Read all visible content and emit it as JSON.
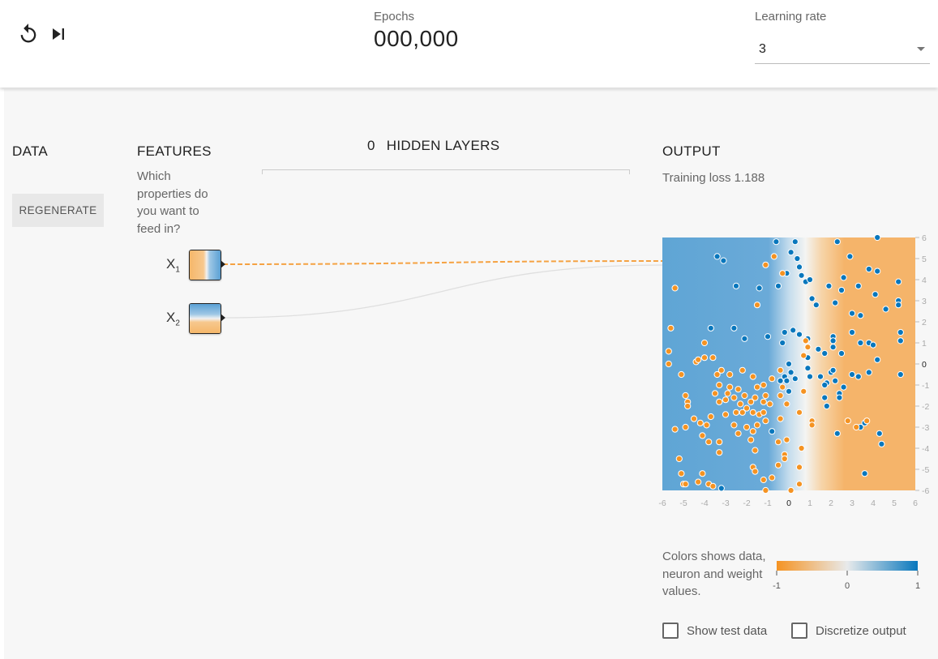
{
  "controls": {
    "reset_icon": "reset-icon",
    "step_icon": "step-forward-icon"
  },
  "epochs": {
    "label": "Epochs",
    "value": "000,000"
  },
  "learning_rate": {
    "label": "Learning rate",
    "value": "3"
  },
  "data_section": {
    "title": "DATA",
    "regenerate_label": "REGENERATE"
  },
  "features_section": {
    "title": "FEATURES",
    "description": "Which properties do you want to feed in?",
    "items": [
      {
        "base": "X",
        "sub": "1"
      },
      {
        "base": "X",
        "sub": "2"
      }
    ]
  },
  "hidden_layers": {
    "count": "0",
    "label": "HIDDEN LAYERS"
  },
  "output_section": {
    "title": "OUTPUT",
    "loss_label": "Training loss",
    "loss_value": "1.188"
  },
  "colors": {
    "orange": "#f59322",
    "light": "#e8eaeb",
    "blue": "#0877bd"
  },
  "color_legend": {
    "description": "Colors shows data, neuron and weight values.",
    "ticks": [
      "-1",
      "0",
      "1"
    ]
  },
  "checkboxes": {
    "show_test_data": "Show test data",
    "discretize_output": "Discretize output"
  },
  "chart_data": {
    "type": "scatter",
    "title": "",
    "xlabel": "",
    "ylabel": "",
    "xlim": [
      -6,
      6
    ],
    "ylim": [
      -6,
      6
    ],
    "x_ticks": [
      "-6",
      "-5",
      "-4",
      "-3",
      "-2",
      "-1",
      "0",
      "1",
      "2",
      "3",
      "4",
      "5",
      "6"
    ],
    "y_ticks": [
      "6",
      "5",
      "4",
      "3",
      "2",
      "1",
      "0",
      "-1",
      "-2",
      "-3",
      "-4",
      "-5",
      "-6"
    ],
    "background": "heatmap of network output: blue (+1) for x < 0.2, orange (-1) for x > 1.4, white at about x = 0.8",
    "series": [
      {
        "color": "blue",
        "points": [
          [
            -3.4,
            5.1
          ],
          [
            -3.1,
            4.9
          ],
          [
            -0.6,
            5.8
          ],
          [
            0.3,
            5.8
          ],
          [
            0.1,
            5.3
          ],
          [
            0.4,
            5.0
          ],
          [
            0.5,
            4.6
          ],
          [
            0.6,
            4.2
          ],
          [
            0.8,
            3.9
          ],
          [
            1.0,
            4.0
          ],
          [
            -0.5,
            3.7
          ],
          [
            -1.4,
            3.6
          ],
          [
            -2.5,
            3.7
          ],
          [
            -0.1,
            4.3
          ],
          [
            2.3,
            5.8
          ],
          [
            2.9,
            5.1
          ],
          [
            3.8,
            4.5
          ],
          [
            4.2,
            4.4
          ],
          [
            4.2,
            6.0
          ],
          [
            5.2,
            3.9
          ],
          [
            2.5,
            3.5
          ],
          [
            2.6,
            4.1
          ],
          [
            1.9,
            3.7
          ],
          [
            3.3,
            3.7
          ],
          [
            4.1,
            3.3
          ],
          [
            1.1,
            3.1
          ],
          [
            1.3,
            2.8
          ],
          [
            2.2,
            2.9
          ],
          [
            3.0,
            2.4
          ],
          [
            3.4,
            2.3
          ],
          [
            4.6,
            2.6
          ],
          [
            5.2,
            3.0
          ],
          [
            5.2,
            2.8
          ],
          [
            -3.7,
            1.7
          ],
          [
            -2.6,
            1.7
          ],
          [
            -2.1,
            1.2
          ],
          [
            -1.0,
            1.3
          ],
          [
            -0.2,
            1.5
          ],
          [
            0.2,
            1.6
          ],
          [
            0.5,
            1.4
          ],
          [
            0.9,
            1.2
          ],
          [
            -0.3,
            1.0
          ],
          [
            0.9,
            0.3
          ],
          [
            1.4,
            0.7
          ],
          [
            1.7,
            0.5
          ],
          [
            2.1,
            1.3
          ],
          [
            2.1,
            1.1
          ],
          [
            2.1,
            0.8
          ],
          [
            2.5,
            0.5
          ],
          [
            3.0,
            1.5
          ],
          [
            3.4,
            1.0
          ],
          [
            3.8,
            1.0
          ],
          [
            4.0,
            0.9
          ],
          [
            5.3,
            1.5
          ],
          [
            5.3,
            1.1
          ],
          [
            0.0,
            0.0
          ],
          [
            0.1,
            -0.4
          ],
          [
            0.3,
            -0.7
          ],
          [
            0.9,
            -0.2
          ],
          [
            1.0,
            -0.6
          ],
          [
            1.5,
            -0.6
          ],
          [
            1.8,
            -0.9
          ],
          [
            2.0,
            -0.4
          ],
          [
            2.1,
            -0.3
          ],
          [
            2.2,
            -0.8
          ],
          [
            1.7,
            -1.0
          ],
          [
            2.4,
            -1.4
          ],
          [
            2.6,
            -1.1
          ],
          [
            3.0,
            -0.5
          ],
          [
            3.3,
            -0.6
          ],
          [
            3.8,
            -0.4
          ],
          [
            4.2,
            0.2
          ],
          [
            5.3,
            -0.5
          ],
          [
            1.7,
            -1.6
          ],
          [
            1.8,
            -2.0
          ],
          [
            2.4,
            -1.6
          ],
          [
            3.4,
            -3.0
          ],
          [
            3.6,
            -2.8
          ],
          [
            4.3,
            -3.3
          ],
          [
            4.4,
            -3.8
          ],
          [
            2.3,
            -3.3
          ],
          [
            -0.8,
            -3.2
          ],
          [
            -0.4,
            -0.8
          ],
          [
            -0.2,
            -0.6
          ],
          [
            -0.1,
            -0.8
          ],
          [
            0.0,
            -1.3
          ],
          [
            3.6,
            -5.2
          ],
          [
            -3.2,
            -5.9
          ]
        ]
      },
      {
        "color": "orange",
        "points": [
          [
            -5.4,
            3.6
          ],
          [
            -5.6,
            1.7
          ],
          [
            -5.7,
            0.6
          ],
          [
            -5.7,
            0.0
          ],
          [
            -5.1,
            -0.5
          ],
          [
            -4.9,
            -1.5
          ],
          [
            -4.8,
            -1.8
          ],
          [
            -4.8,
            -2.0
          ],
          [
            -4.4,
            0.1
          ],
          [
            -4.3,
            0.2
          ],
          [
            -4.0,
            0.3
          ],
          [
            -4.0,
            1.0
          ],
          [
            -3.6,
            0.3
          ],
          [
            -3.4,
            -0.5
          ],
          [
            -3.3,
            -1.0
          ],
          [
            -3.2,
            -0.3
          ],
          [
            -3.5,
            -1.4
          ],
          [
            -3.3,
            -1.8
          ],
          [
            -3.0,
            -1.7
          ],
          [
            -2.8,
            -0.5
          ],
          [
            -2.9,
            -1.4
          ],
          [
            -2.6,
            -1.6
          ],
          [
            -2.4,
            -1.2
          ],
          [
            -2.2,
            -0.3
          ],
          [
            -2.1,
            -1.5
          ],
          [
            -2.3,
            -1.9
          ],
          [
            -2.0,
            -2.1
          ],
          [
            -1.8,
            -1.8
          ],
          [
            -1.6,
            -1.6
          ],
          [
            -2.5,
            -2.3
          ],
          [
            -2.2,
            -2.3
          ],
          [
            -1.7,
            -2.3
          ],
          [
            -1.4,
            -2.4
          ],
          [
            -1.2,
            -2.3
          ],
          [
            -1.7,
            -0.6
          ],
          [
            -1.5,
            -1.1
          ],
          [
            -1.2,
            -1.0
          ],
          [
            -1.1,
            -1.5
          ],
          [
            -1.2,
            -1.8
          ],
          [
            -0.9,
            -1.9
          ],
          [
            -0.8,
            -0.7
          ],
          [
            -0.4,
            -0.3
          ],
          [
            -0.3,
            -1.1
          ],
          [
            -0.4,
            -1.5
          ],
          [
            -0.1,
            -1.9
          ],
          [
            -0.4,
            -2.6
          ],
          [
            -1.1,
            -2.7
          ],
          [
            -1.5,
            -2.9
          ],
          [
            -1.7,
            -3.2
          ],
          [
            -1.8,
            -3.6
          ],
          [
            -1.6,
            -4.1
          ],
          [
            -1.7,
            -4.9
          ],
          [
            -1.6,
            -5.1
          ],
          [
            -1.2,
            -5.5
          ],
          [
            -1.1,
            -6.0
          ],
          [
            -0.8,
            -5.4
          ],
          [
            -0.5,
            -3.7
          ],
          [
            -0.1,
            -3.6
          ],
          [
            -0.2,
            -4.3
          ],
          [
            -0.2,
            -4.5
          ],
          [
            -0.5,
            -4.8
          ],
          [
            -2.0,
            -3.0
          ],
          [
            -2.6,
            -2.9
          ],
          [
            -2.4,
            -3.3
          ],
          [
            -3.3,
            -3.7
          ],
          [
            -3.3,
            -4.2
          ],
          [
            -4.1,
            -5.2
          ],
          [
            -3.8,
            -5.7
          ],
          [
            -3.6,
            -5.8
          ],
          [
            -4.3,
            -5.6
          ],
          [
            -5.1,
            -5.2
          ],
          [
            -5.0,
            -5.7
          ],
          [
            -4.9,
            -5.7
          ],
          [
            -5.2,
            -4.5
          ],
          [
            -5.4,
            -3.1
          ],
          [
            -4.9,
            -3.0
          ],
          [
            -4.5,
            -2.6
          ],
          [
            -4.2,
            -2.8
          ],
          [
            -4.1,
            -3.4
          ],
          [
            -3.9,
            -2.9
          ],
          [
            -3.8,
            -3.7
          ],
          [
            -3.7,
            -2.5
          ],
          [
            -3.0,
            -2.4
          ],
          [
            0.6,
            -4.0
          ],
          [
            0.5,
            -4.9
          ],
          [
            0.5,
            -5.7
          ],
          [
            0.1,
            -6.0
          ],
          [
            0.5,
            -2.3
          ],
          [
            0.7,
            -1.3
          ],
          [
            1.1,
            -2.7
          ],
          [
            1.1,
            -2.9
          ],
          [
            0.8,
            1.1
          ],
          [
            0.7,
            0.4
          ],
          [
            0.9,
            0.8
          ],
          [
            -0.3,
            4.3
          ],
          [
            -1.1,
            4.7
          ],
          [
            -0.7,
            5.1
          ],
          [
            -1.5,
            2.8
          ],
          [
            -2.8,
            -1.1
          ],
          [
            2.8,
            -2.7
          ],
          [
            3.2,
            -3.0
          ],
          [
            3.7,
            -2.7
          ]
        ]
      }
    ]
  }
}
